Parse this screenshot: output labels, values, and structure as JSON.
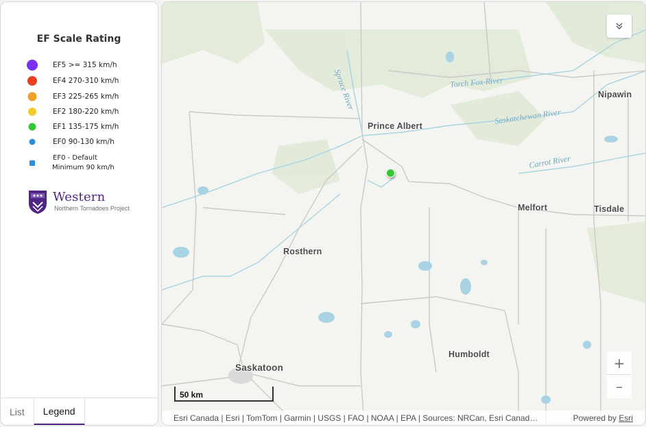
{
  "legend": {
    "title": "EF Scale Rating",
    "items": [
      {
        "text": "EF5   >= 315 km/h",
        "color": "#7b2ff0",
        "shape": "circle"
      },
      {
        "text": "EF4  270-310 km/h",
        "color": "#e8401c",
        "shape": "circle"
      },
      {
        "text": "EF3  225-265 km/h",
        "color": "#f0a02a",
        "shape": "circle"
      },
      {
        "text": "EF2  180-220 km/h",
        "color": "#f2cc28",
        "shape": "circle"
      },
      {
        "text": "EF1  135-175 km/h",
        "color": "#35c735",
        "shape": "circle"
      },
      {
        "text": "EF0  90-130 km/h",
        "color": "#2f8fd8",
        "shape": "circle"
      },
      {
        "text_line1": "EF0 - Default",
        "text_line2": "Minimum 90 km/h",
        "color": "#2f8fd8",
        "shape": "square"
      }
    ],
    "logo": {
      "name": "Western",
      "subtitle": "Northern Tornadoes Project",
      "color": "#4f2683"
    }
  },
  "tabs": [
    {
      "label": "List",
      "active": false
    },
    {
      "label": "Legend",
      "active": true
    }
  ],
  "map": {
    "places": [
      "Prince Albert",
      "Nipawin",
      "Melfort",
      "Tisdale",
      "Rosthern",
      "Humboldt",
      "Saskatoon"
    ],
    "rivers": [
      "Spruce River",
      "Torch Fox River",
      "Saskatchewan River",
      "Carrot River"
    ],
    "scale_label": "50 km",
    "zoom_in": "+",
    "zoom_out": "–",
    "attribution": "Esri Canada | Esri | TomTom | Garmin | USGS | FAO | NOAA | EPA | Sources: NRCan, Esri Canad…",
    "powered_prefix": "Powered by ",
    "powered_link": "Esri",
    "marker_rating": "EF1"
  }
}
